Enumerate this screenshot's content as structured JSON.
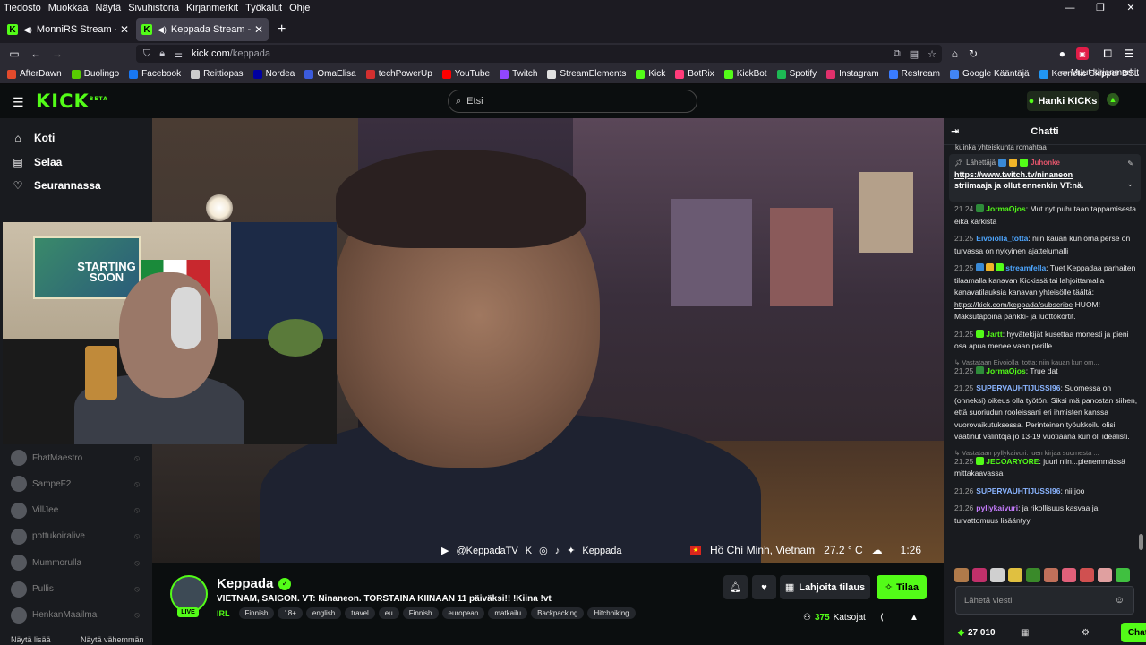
{
  "browser": {
    "menu": [
      "Tiedosto",
      "Muokkaa",
      "Näytä",
      "Sivuhistoria",
      "Kirjanmerkit",
      "Työkalut",
      "Ohje"
    ],
    "tabs": [
      {
        "title": "MonniRS Stream - Watch Li"
      },
      {
        "title": "Keppada Stream - Watch L"
      }
    ],
    "url_host": "kick.com",
    "url_path": "/keppada",
    "bookmarks": [
      {
        "label": "AfterDawn",
        "color": "#e34a2c"
      },
      {
        "label": "Duolingo",
        "color": "#58cc02"
      },
      {
        "label": "Facebook",
        "color": "#1877f2"
      },
      {
        "label": "Reittiopas",
        "color": "#cccccc"
      },
      {
        "label": "Nordea",
        "color": "#0000a0"
      },
      {
        "label": "OmaElisa",
        "color": "#3b5bdb"
      },
      {
        "label": "techPowerUp",
        "color": "#d32f2f"
      },
      {
        "label": "YouTube",
        "color": "#ff0000"
      },
      {
        "label": "Twitch",
        "color": "#9146ff"
      },
      {
        "label": "StreamElements",
        "color": "#e0e0e0"
      },
      {
        "label": "Kick",
        "color": "#53fc18"
      },
      {
        "label": "BotRix",
        "color": "#ff3b7a"
      },
      {
        "label": "KickBot",
        "color": "#53fc18"
      },
      {
        "label": "Spotify",
        "color": "#1db954"
      },
      {
        "label": "Instagram",
        "color": "#e1306c"
      },
      {
        "label": "Restream",
        "color": "#3a7cff"
      },
      {
        "label": "Google Kääntäjä",
        "color": "#4285f4"
      },
      {
        "label": "Keenetic Skipper DSL",
        "color": "#2196f3"
      }
    ],
    "other_bookmarks": "Muut kirjanmerkit"
  },
  "kick": {
    "logo": "KICK",
    "logo_beta": "BETA",
    "search_placeholder": "Etsi",
    "get_kicks": "Hanki KICKs"
  },
  "sidebar": {
    "nav": [
      {
        "label": "Koti",
        "icon": "home-icon"
      },
      {
        "label": "Selaa",
        "icon": "browse-icon"
      },
      {
        "label": "Seurannassa",
        "icon": "heart-icon"
      }
    ],
    "following": [
      "FhatMaestro",
      "SampeF2",
      "VillJee",
      "pottukoiralive",
      "Mummorulla",
      "Pullis",
      "HenkanMaailma"
    ],
    "show_more": "Näytä lisää",
    "show_less": "Näytä vähemmän"
  },
  "video": {
    "webcam_poster_text": "STARTING SOON",
    "social_handle": "@KeppadaTV",
    "social_name": "Keppada",
    "location": "Hồ Chí Minh, Vietnam",
    "temperature": "27.2 ° C",
    "time": "1:26"
  },
  "stream": {
    "name": "Keppada",
    "live": "LIVE",
    "title": "VIETNAM, SAIGON. VT: Ninaneon. TORSTAINA KIINAAN 11 päiväksi!! !Kiina !vt",
    "category": "IRL",
    "tags": [
      "Finnish",
      "18+",
      "english",
      "travel",
      "eu",
      "Finnish",
      "european",
      "matkailu",
      "Backpacking",
      "Hitchhiking"
    ],
    "gift_label": "Lahjoita tilaus",
    "subscribe_label": "Tilaa",
    "viewer_count": "375",
    "viewer_label": "Katsojat"
  },
  "chat": {
    "title": "Chatti",
    "cut_line": "kuinka yhteiskunta romahtaa",
    "pinned": {
      "sender_label": "Lähettäjä",
      "sender": "Juhonke",
      "link": "https://www.twitch.tv/ninaneon",
      "message": "striimaaja ja ollut ennenkin VT:nä."
    },
    "messages": [
      {
        "reply": "",
        "time": "21.24",
        "user": "JormaOjos",
        "color": "#53fc18",
        "badges": [
          "#2e8b3a"
        ],
        "text": "Mut nyt puhutaan tappamisesta eikä karkista",
        "link": ""
      },
      {
        "reply": "",
        "time": "21.25",
        "user": "Eivoiolla_totta",
        "color": "#4da6ff",
        "badges": [],
        "text": "niin kauan kun oma perse on turvassa on nykyinen ajattelumalli",
        "link": ""
      },
      {
        "reply": "",
        "time": "21.25",
        "user": "streamfella",
        "color": "#4da6ff",
        "badges": [
          "#3a8ad6",
          "#f0b429",
          "#53fc18"
        ],
        "text": "Tuet Keppadaa parhaiten tilaamalla kanavan Kickissä tai lahjoittamalla kanavatilauksia kanavan yhteisölle täältä:",
        "link": "https://kick.com/keppada/subscribe",
        "after": "HUOM! Maksutapoina pankki- ja luottokortit."
      },
      {
        "reply": "",
        "time": "21.25",
        "user": "Jartt",
        "color": "#53fc18",
        "badges": [
          "#53fc18"
        ],
        "text": "hyvätekijät kusettaa monesti ja pieni osa apua menee vaan perille",
        "link": ""
      },
      {
        "reply": "Vastataan Eivoiolla_totta: niin kauan kun om...",
        "time": "21.25",
        "user": "JormaOjos",
        "color": "#53fc18",
        "badges": [
          "#2e8b3a"
        ],
        "text": "True dat",
        "link": ""
      },
      {
        "reply": "",
        "time": "21.25",
        "user": "SUPERVAUHTIJUSSI96",
        "color": "#8ab4ff",
        "badges": [],
        "text": "Suomessa on (onneksi) oikeus olla työtön. Siksi mä panostan siihen, että suoriudun rooleissani eri ihmisten kanssa vuorovaikutuksessa. Perinteinen työukkoilu olisi vaatinut valintoja jo 13-19 vuotiaana kun oli idealisti.",
        "link": ""
      },
      {
        "reply": "Vastataan pyllykaivuri: luen kirjaa suomesta ...",
        "time": "21.25",
        "user": "JECOARYORE",
        "color": "#53fc18",
        "badges": [
          "#53fc18"
        ],
        "text": "juuri niin...pienemmässä mittakaavassa",
        "link": ""
      },
      {
        "reply": "",
        "time": "21.26",
        "user": "SUPERVAUHTIJUSSI96",
        "color": "#8ab4ff",
        "badges": [],
        "text": "nii joo",
        "link": ""
      },
      {
        "reply": "",
        "time": "21.26",
        "user": "pyllykaivuri",
        "color": "#c77dff",
        "badges": [],
        "text": "ja rikollisuus kasvaa ja turvattomuus lisääntyy",
        "link": ""
      }
    ],
    "emote_colors": [
      "#b07a4a",
      "#c0306a",
      "#d0d0d0",
      "#e0c040",
      "#3a8a2a",
      "#c0705a",
      "#e0607a",
      "#d05050",
      "#e0a0a0",
      "#40c040"
    ],
    "input_placeholder": "Lähetä viesti",
    "points": "27 010",
    "send_label": "Chatti"
  }
}
